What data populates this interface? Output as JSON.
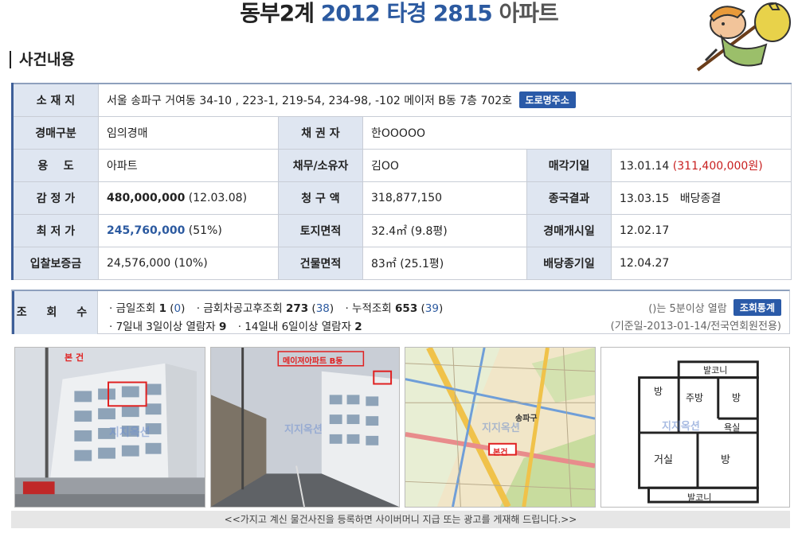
{
  "header": {
    "title_part1": "동부2계",
    "title_part2": "2012 타경 2815",
    "title_part3": "아파트",
    "section_title": "사건내용"
  },
  "case": {
    "location_label": "소 재 지",
    "location_value": "서울 송파구 거여동 34-10 , 223-1, 219-54, 234-98, -102 메이저 B동 7층 702호",
    "road_address_button": "도로명주소",
    "auction_type_label": "경매구분",
    "auction_type_value": "임의경매",
    "creditor_label": "채 권 자",
    "creditor_value": "한OOOOO",
    "usage_label": "용    도",
    "usage_value": "아파트",
    "debtor_label": "채무/소유자",
    "debtor_value": "김OO",
    "sale_date_label": "매각기일",
    "sale_date_value": "13.01.14",
    "sale_price_value": "(311,400,000원)",
    "appraisal_label": "감 정 가",
    "appraisal_amount": "480,000,000",
    "appraisal_date": "(12.03.08)",
    "claim_label": "청 구 액",
    "claim_value": "318,877,150",
    "final_result_label": "종국결과",
    "final_result_value": "13.03.15   배당종결",
    "minimum_label": "최 저 가",
    "minimum_amount": "245,760,000",
    "minimum_pct": "(51%)",
    "land_area_label": "토지면적",
    "land_area_value": "32.4㎡ (9.8평)",
    "start_date_label": "경매개시일",
    "start_date_value": "12.02.17",
    "deposit_label": "입찰보증금",
    "deposit_value": "24,576,000 (10%)",
    "building_area_label": "건물면적",
    "building_area_value": "83㎡ (25.1평)",
    "dividend_deadline_label": "배당종기일",
    "dividend_deadline_value": "12.04.27"
  },
  "views": {
    "label": "조 회 수",
    "today_label": "· 금일조회",
    "today_count": "1",
    "today_sub": "0",
    "after_notice_label": "· 금회차공고후조회",
    "after_notice_count": "273",
    "after_notice_sub": "38",
    "total_label": "· 누적조회",
    "total_count": "653",
    "total_sub": "39",
    "week_label": "· 7일내 3일이상 열람자",
    "week_count": "9",
    "twoweek_label": "· 14일내 6일이상 열람자",
    "twoweek_count": "2",
    "note": "()는 5분이상 열람",
    "stats_button": "조회통계",
    "basis": "(기준일-2013-01-14/전국연회원전용)"
  },
  "photos": {
    "photo1_label": "본 건",
    "photo2_label": "메이져아파트 B동",
    "map_label": "본건",
    "map_district": "송파구",
    "watermark": "지지옥션",
    "floor_balcony_top": "발코니",
    "floor_room1": "방",
    "floor_kitchen": "주방",
    "floor_room2": "방",
    "floor_bath": "욕실",
    "floor_living": "거실",
    "floor_room3": "방",
    "floor_balcony_bottom": "발코니"
  },
  "footer": {
    "text": "<<가지고 계신 물건사진을 등록하면 사이버머니 지급 또는 광고를 게재해 드립니다.>>"
  },
  "colors": {
    "accent_blue": "#2c5aa0",
    "label_bg": "#dfe6f1",
    "price_red": "#c81e1e",
    "button_blue": "#2a5aa8"
  }
}
